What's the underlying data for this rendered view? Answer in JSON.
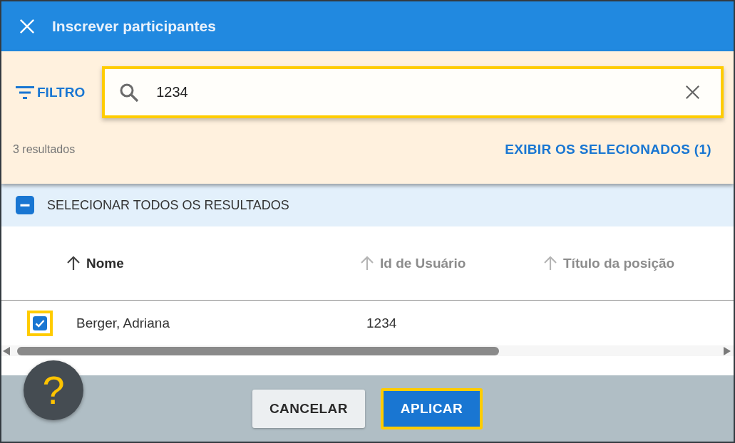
{
  "dialog": {
    "title": "Inscrever participantes"
  },
  "filter_button": {
    "label": "FILTRO"
  },
  "search": {
    "value": "1234",
    "highlighted": true
  },
  "results_count": "3 resultados",
  "show_selected_link": "EXIBIR OS SELECIONADOS (1)",
  "select_all": {
    "label": "SELECIONAR TODOS OS RESULTADOS",
    "checked": true,
    "partial": true
  },
  "table": {
    "columns": [
      {
        "label": "Nome",
        "sorted": true
      },
      {
        "label": "Id de Usuário",
        "sorted": false
      },
      {
        "label": "Título da posição",
        "sorted": false
      }
    ],
    "rows": [
      {
        "checked": true,
        "highlighted": true,
        "name": "Berger, Adriana",
        "user_id": "1234"
      }
    ]
  },
  "help_button": {
    "label": "?"
  },
  "footer": {
    "buttons": [
      {
        "label": "CANCELAR",
        "kind": "secondary",
        "highlighted": false
      },
      {
        "label": "APLICAR",
        "kind": "primary",
        "highlighted": true
      }
    ]
  }
}
